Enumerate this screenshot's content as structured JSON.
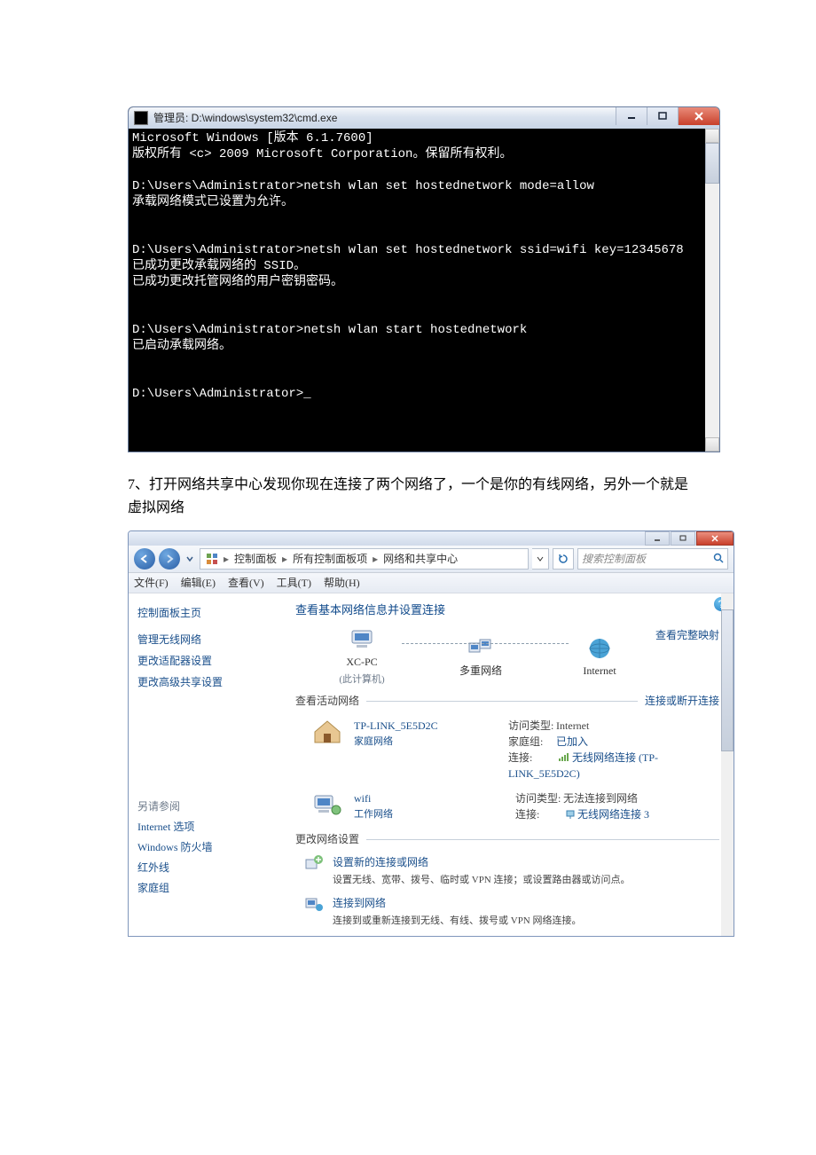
{
  "cmd": {
    "title": "管理员: D:\\windows\\system32\\cmd.exe",
    "lines": [
      "Microsoft Windows [版本 6.1.7600]",
      "版权所有 <c> 2009 Microsoft Corporation。保留所有权利。",
      "",
      "D:\\Users\\Administrator>netsh wlan set hostednetwork mode=allow",
      "承载网络模式已设置为允许。",
      "",
      "",
      "D:\\Users\\Administrator>netsh wlan set hostednetwork ssid=wifi key=12345678",
      "已成功更改承载网络的 SSID。",
      "已成功更改托管网络的用户密钥密码。",
      "",
      "",
      "D:\\Users\\Administrator>netsh wlan start hostednetwork",
      "已启动承载网络。",
      "",
      "",
      "D:\\Users\\Administrator>_"
    ]
  },
  "caption": "7、打开网络共享中心发现你现在连接了两个网络了，一个是你的有线网络，另外一个就是虚拟网络",
  "nc": {
    "breadcrumb": [
      "控制面板",
      "所有控制面板项",
      "网络和共享中心"
    ],
    "search_placeholder": "搜索控制面板",
    "menu": [
      "文件(F)",
      "编辑(E)",
      "查看(V)",
      "工具(T)",
      "帮助(H)"
    ],
    "side": {
      "home": "控制面板主页",
      "links": [
        "管理无线网络",
        "更改适配器设置",
        "更改高级共享设置"
      ],
      "see_also": "另请参阅",
      "see_items": [
        "Internet 选项",
        "Windows 防火墙",
        "红外线",
        "家庭组"
      ]
    },
    "main": {
      "heading": "查看基本网络信息并设置连接",
      "map_link": "查看完整映射",
      "node_pc": "XC-PC",
      "node_pc_sub": "(此计算机)",
      "node_multi": "多重网络",
      "node_net": "Internet",
      "active_label": "查看活动网络",
      "active_link": "连接或断开连接",
      "n1_name": "TP-LINK_5E5D2C",
      "n1_type": "家庭网络",
      "n1_access_l": "访问类型:",
      "n1_access_v": "Internet",
      "n1_hg_l": "家庭组:",
      "n1_hg_v": "已加入",
      "n1_conn_l": "连接:",
      "n1_conn_v": "无线网络连接 (TP-LINK_5E5D2C)",
      "n2_name": "wifi",
      "n2_type": "工作网络",
      "n2_access_l": "访问类型:",
      "n2_access_v": "无法连接到网络",
      "n2_conn_l": "连接:",
      "n2_conn_v": "无线网络连接 3",
      "settings_label": "更改网络设置",
      "s1_t": "设置新的连接或网络",
      "s1_d": "设置无线、宽带、拨号、临时或 VPN 连接；或设置路由器或访问点。",
      "s2_t": "连接到网络",
      "s2_d": "连接到或重新连接到无线、有线、拨号或 VPN 网络连接。"
    }
  }
}
